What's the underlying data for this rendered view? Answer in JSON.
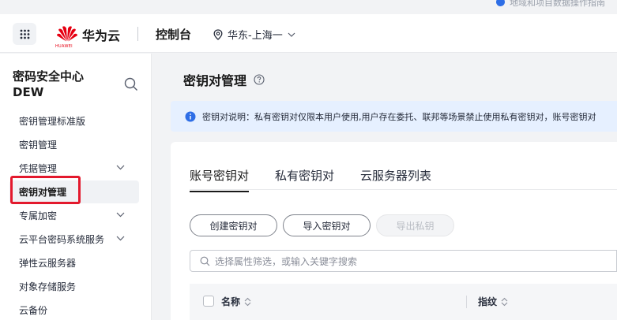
{
  "top_strip": {
    "text": "地域和项目数据操作指南"
  },
  "header": {
    "logo_text": "HUAWEI",
    "brand": "华为云",
    "console": "控制台",
    "region": "华东-上海一"
  },
  "sidebar": {
    "title_line1": "密码安全中心",
    "title_line2": "DEW",
    "items": [
      {
        "label": "密钥管理标准版",
        "expandable": false
      },
      {
        "label": "密钥管理",
        "expandable": false
      },
      {
        "label": "凭据管理",
        "expandable": true
      },
      {
        "label": "密钥对管理",
        "expandable": false,
        "active": true
      },
      {
        "label": "专属加密",
        "expandable": true
      },
      {
        "label": "云平台密码系统服务",
        "expandable": true
      },
      {
        "label": "弹性云服务器",
        "expandable": false
      },
      {
        "label": "对象存储服务",
        "expandable": false
      },
      {
        "label": "云备份",
        "expandable": false
      }
    ]
  },
  "main": {
    "page_title": "密钥对管理",
    "alert": "密钥对说明：私有密钥对仅限本用户使用,用户存在委托、联邦等场景禁止使用私有密钥对，账号密钥对",
    "tabs": [
      "账号密钥对",
      "私有密钥对",
      "云服务器列表"
    ],
    "buttons": {
      "create": "创建密钥对",
      "import": "导入密钥对",
      "export": "导出私钥"
    },
    "search_placeholder": "选择属性筛选，或输入关键字搜索",
    "columns": [
      "名称",
      "指纹"
    ]
  },
  "colors": {
    "brand_red": "#e60012",
    "highlight_red": "#e3192d",
    "info_blue": "#2e6ee6",
    "alert_bg": "#e6f0ff"
  }
}
